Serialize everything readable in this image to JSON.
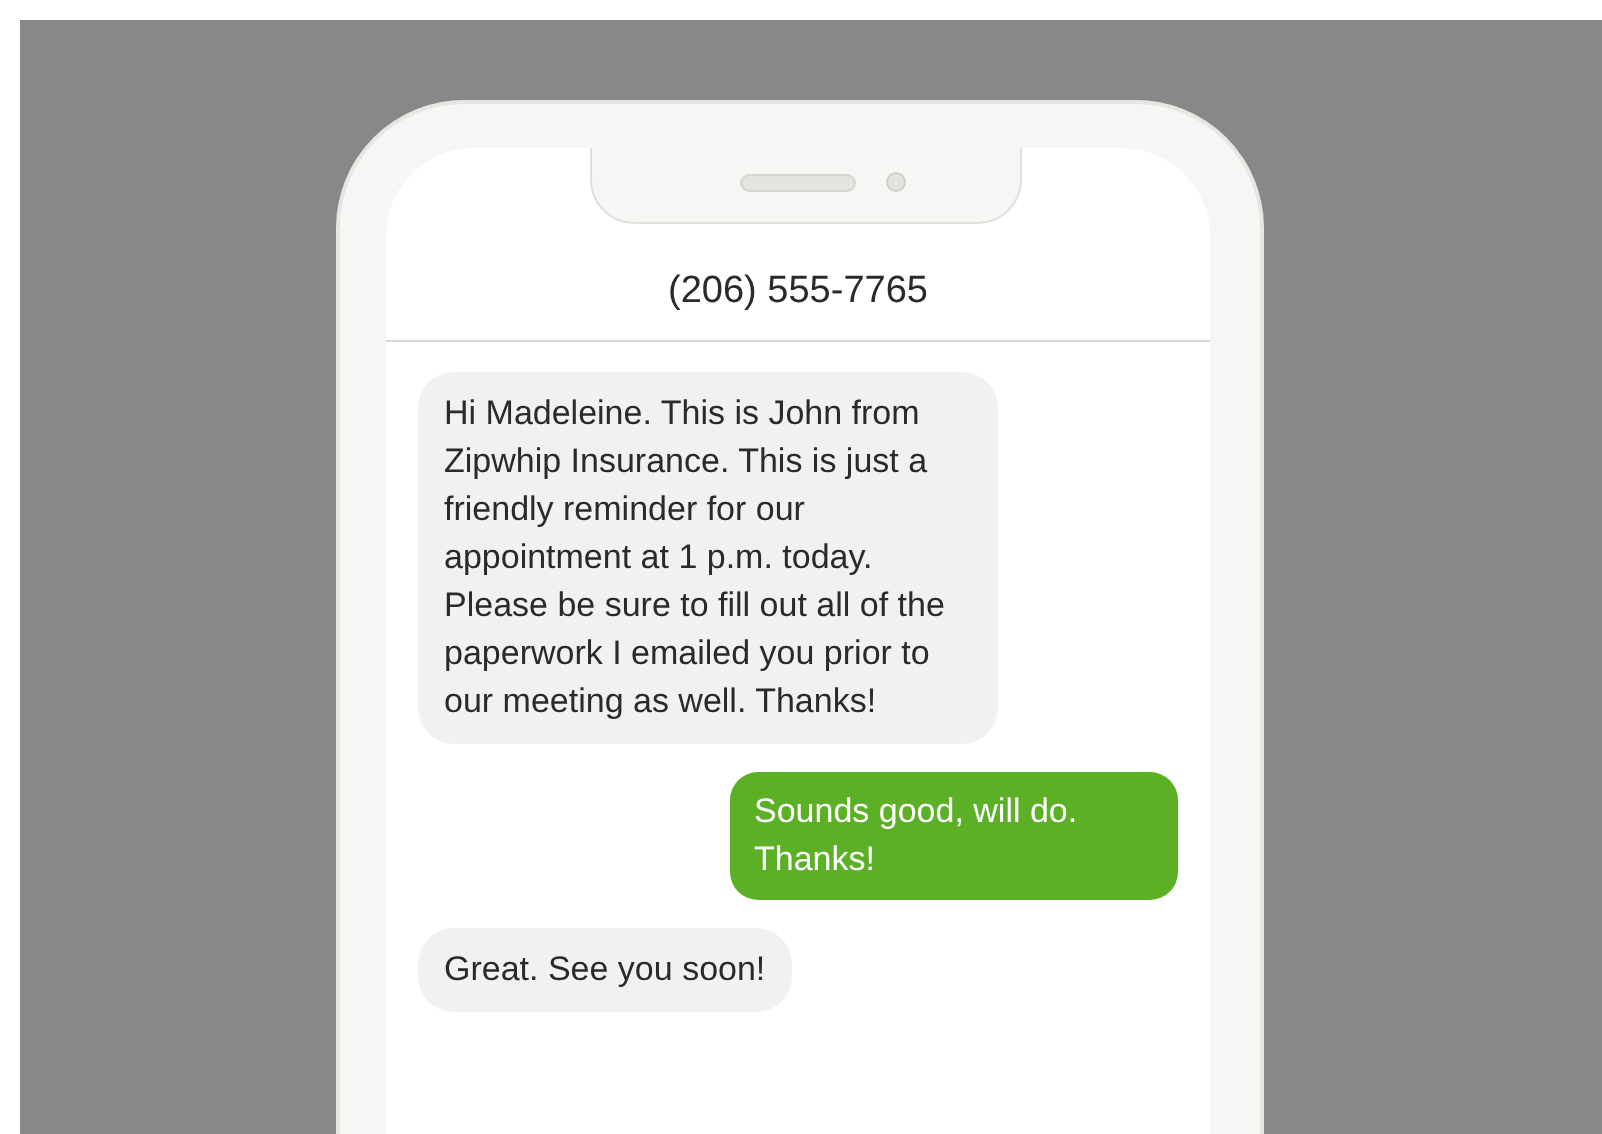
{
  "header": {
    "title": "(206) 555-7765"
  },
  "messages": [
    {
      "kind": "received",
      "text": "Hi Madeleine. This is John from Zipwhip Insurance. This is just a friendly reminder for our appointment at 1 p.m. today. Please be sure to fill out all of the paperwork I emailed you prior to our meeting as well. Thanks!"
    },
    {
      "kind": "sent",
      "text": "Sounds good, will do. Thanks!"
    },
    {
      "kind": "received",
      "text": "Great. See you soon!"
    }
  ]
}
